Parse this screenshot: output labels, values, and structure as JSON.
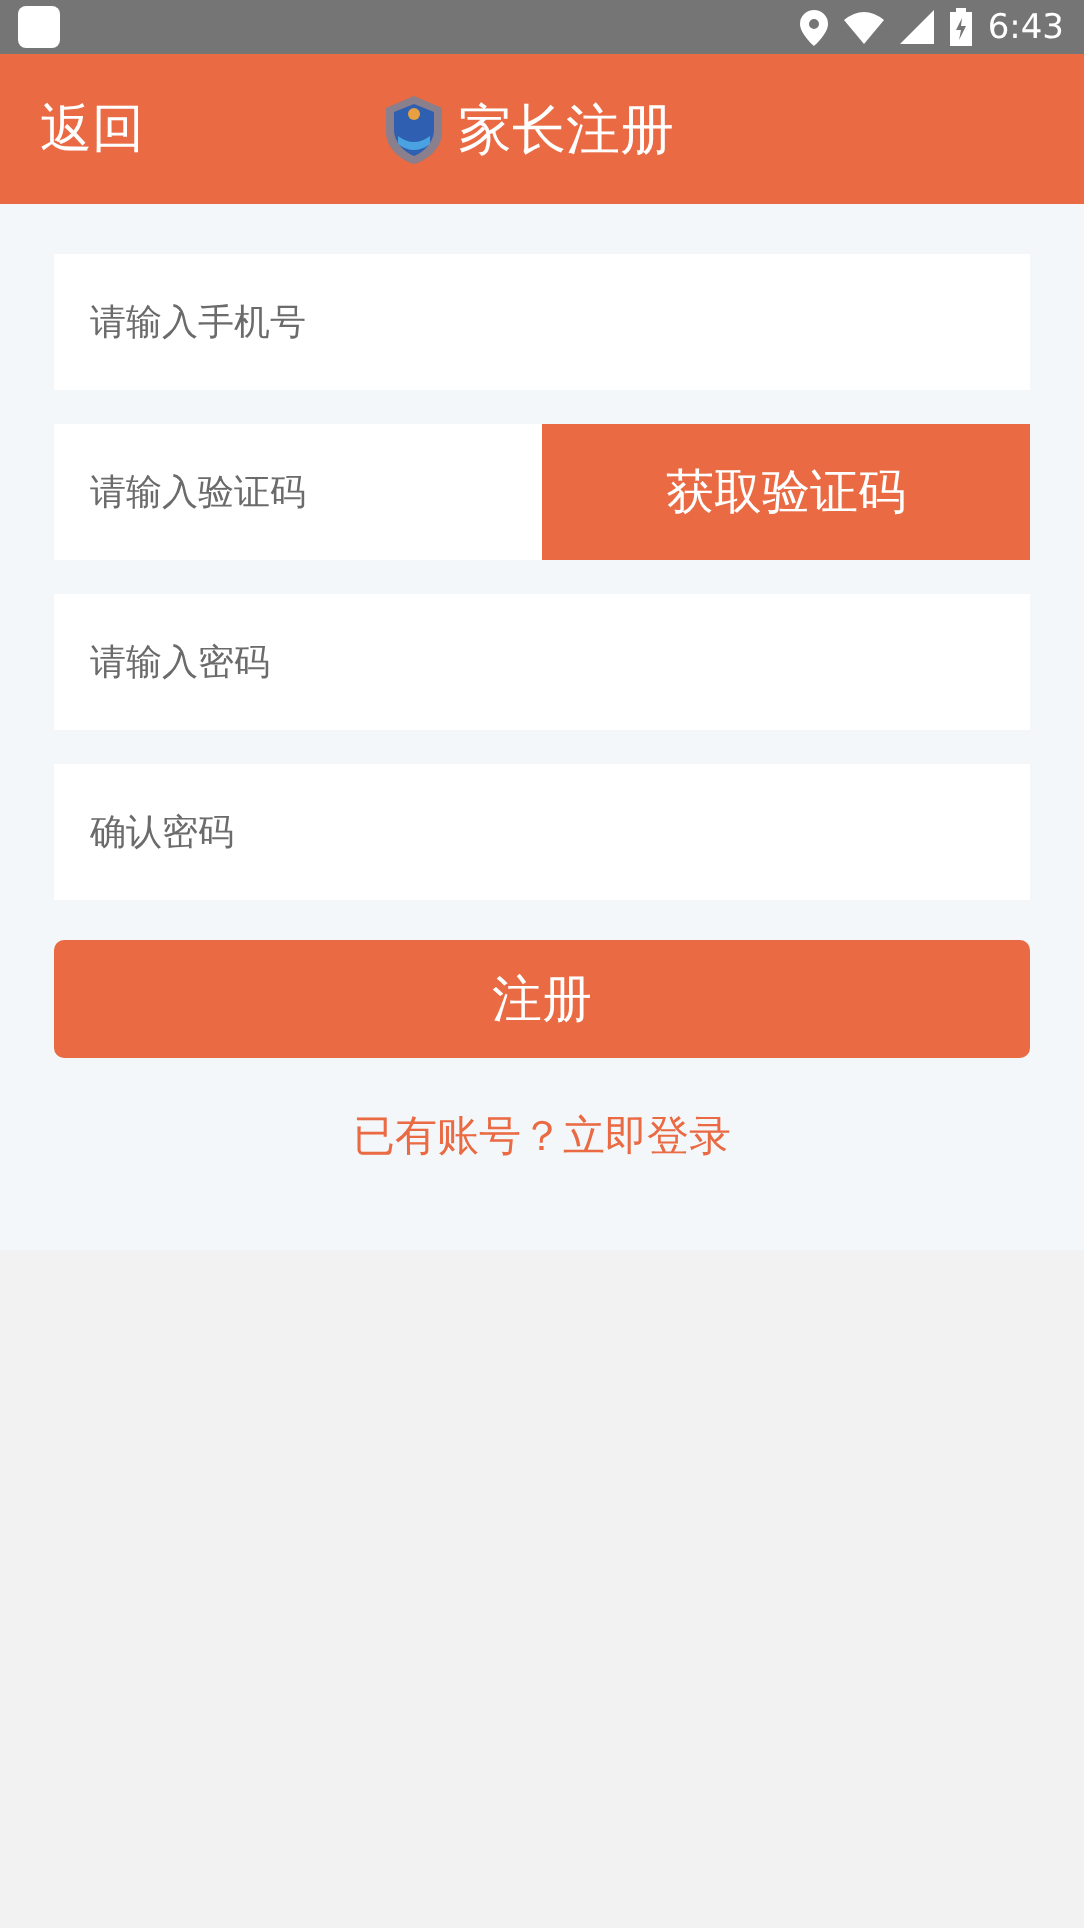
{
  "status_bar": {
    "time": "6:43"
  },
  "header": {
    "back": "返回",
    "title": "家长注册"
  },
  "fields": [
    {
      "kind": "text",
      "placeholder": "请输入手机号"
    },
    {
      "kind": "code",
      "placeholder": "请输入验证码",
      "button": "获取验证码"
    },
    {
      "kind": "password",
      "placeholder": "请输入密码"
    },
    {
      "kind": "password",
      "placeholder": "确认密码"
    }
  ],
  "submit": "注册",
  "login_link": "已有账号？立即登录"
}
